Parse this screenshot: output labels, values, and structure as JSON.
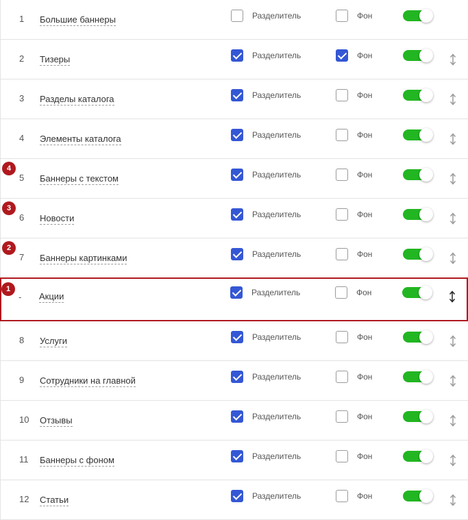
{
  "labels": {
    "separator": "Разделитель",
    "background": "Фон"
  },
  "colors": {
    "accent_checkbox": "#3457d5",
    "toggle_on": "#22b622",
    "highlight_border": "#b0191e",
    "badge": "#b0191e"
  },
  "rows": [
    {
      "num": "1",
      "name": "Большие баннеры",
      "separator": false,
      "background": false,
      "enabled": true,
      "draggable": false,
      "badge": "",
      "highlight": false
    },
    {
      "num": "2",
      "name": "Тизеры",
      "separator": true,
      "background": true,
      "enabled": true,
      "draggable": true,
      "badge": "",
      "highlight": false
    },
    {
      "num": "3",
      "name": "Разделы каталога",
      "separator": true,
      "background": false,
      "enabled": true,
      "draggable": true,
      "badge": "",
      "highlight": false
    },
    {
      "num": "4",
      "name": "Элементы каталога",
      "separator": true,
      "background": false,
      "enabled": true,
      "draggable": true,
      "badge": "",
      "highlight": false
    },
    {
      "num": "5",
      "name": "Баннеры с текстом",
      "separator": true,
      "background": false,
      "enabled": true,
      "draggable": true,
      "badge": "4",
      "highlight": false
    },
    {
      "num": "6",
      "name": "Новости",
      "separator": true,
      "background": false,
      "enabled": true,
      "draggable": true,
      "badge": "3",
      "highlight": false
    },
    {
      "num": "7",
      "name": "Баннеры картинками",
      "separator": true,
      "background": false,
      "enabled": true,
      "draggable": true,
      "badge": "2",
      "highlight": false
    },
    {
      "num": "-",
      "name": "Акции",
      "separator": true,
      "background": false,
      "enabled": true,
      "draggable": true,
      "badge": "1",
      "highlight": true
    },
    {
      "num": "8",
      "name": "Услуги",
      "separator": true,
      "background": false,
      "enabled": true,
      "draggable": true,
      "badge": "",
      "highlight": false
    },
    {
      "num": "9",
      "name": "Сотрудники на главной",
      "separator": true,
      "background": false,
      "enabled": true,
      "draggable": true,
      "badge": "",
      "highlight": false
    },
    {
      "num": "10",
      "name": "Отзывы",
      "separator": true,
      "background": false,
      "enabled": true,
      "draggable": true,
      "badge": "",
      "highlight": false
    },
    {
      "num": "11",
      "name": "Баннеры с фоном",
      "separator": true,
      "background": false,
      "enabled": true,
      "draggable": true,
      "badge": "",
      "highlight": false
    },
    {
      "num": "12",
      "name": "Статьи",
      "separator": true,
      "background": false,
      "enabled": true,
      "draggable": true,
      "badge": "",
      "highlight": false
    }
  ]
}
